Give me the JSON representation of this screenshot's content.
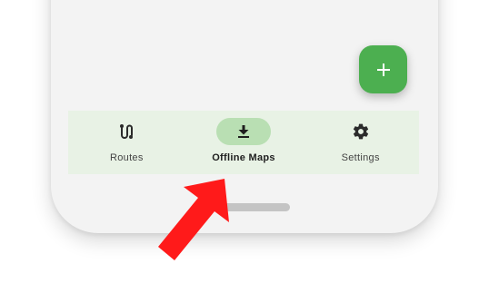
{
  "fab": {
    "icon": "plus-icon",
    "color": "#4caf50"
  },
  "bottom_nav": {
    "background": "#e8f2e5",
    "items": [
      {
        "label": "Routes",
        "icon": "route-icon",
        "active": false
      },
      {
        "label": "Offline Maps",
        "icon": "download-icon",
        "active": true
      },
      {
        "label": "Settings",
        "icon": "gear-icon",
        "active": false
      }
    ]
  },
  "annotation": {
    "icon": "red-arrow-icon",
    "color": "#ff1a1a"
  }
}
